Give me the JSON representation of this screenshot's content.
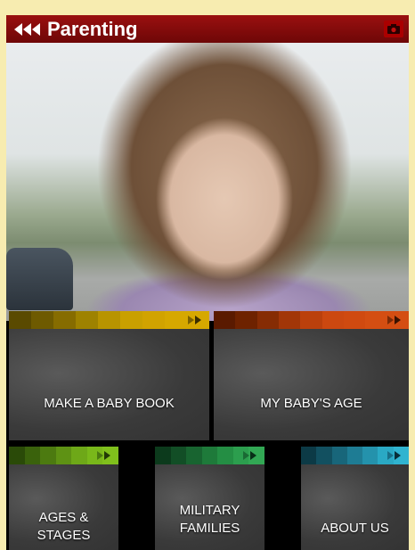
{
  "header": {
    "title": "Parenting",
    "back_icon": "triple-left-arrow-icon",
    "camera_icon": "camera-icon"
  },
  "colors": {
    "header_red": "#8a0c0c",
    "tile_gold": "#d1a300",
    "tile_orange": "#d04a10",
    "tile_green": "#79b81a",
    "tile_teal_green": "#2c9e4e",
    "tile_cyan": "#2aa9c4"
  },
  "tiles": {
    "baby_book": {
      "label": "MAKE A BABY BOOK"
    },
    "baby_age": {
      "label": "MY BABY'S AGE"
    },
    "ages_stages": {
      "line1": "AGES &",
      "line2": "STAGES"
    },
    "military": {
      "line1": "MILITARY",
      "line2": "FAMILIES"
    },
    "about": {
      "label": "ABOUT US"
    }
  }
}
